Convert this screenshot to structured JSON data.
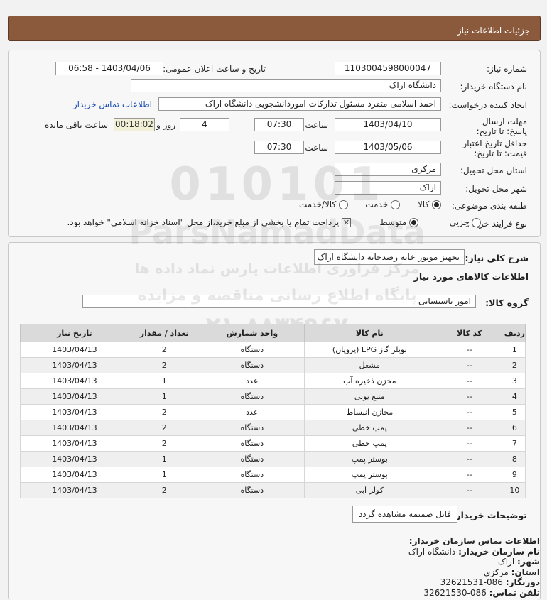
{
  "page_title": "جزئیات اطلاعات نیاز",
  "form": {
    "need_number_label": "شماره نیاز:",
    "need_number": "1103004598000047",
    "announce_label": "تاریخ و ساعت اعلان عمومی:",
    "announce_value": "1403/04/06 - 06:58",
    "buyer_org_label": "نام دستگاه خریدار:",
    "buyer_org": "دانشگاه اراک",
    "creator_label": "ایجاد کننده درخواست:",
    "creator": "احمد  اسلامی متفرد مسئول تدارکات اموردانشجویی دانشگاه اراک",
    "contact_link": "اطلاعات تماس خریدار",
    "deadline_label": "مهلت ارسال پاسخ: تا تاریخ:",
    "deadline_date": "1403/04/10",
    "time_label": "ساعت",
    "deadline_time": "07:30",
    "days_value": "4",
    "days_label": "روز و",
    "remaining_time": "00:18:02",
    "remaining_label": "ساعت باقی مانده",
    "validity_label": "حداقل تاریخ اعتبار قیمت: تا تاریخ:",
    "validity_date": "1403/05/06",
    "validity_time": "07:30",
    "province_label": "استان محل تحویل:",
    "province": "مرکزی",
    "city_label": "شهر محل تحویل:",
    "city": "اراک",
    "category_label": "طبقه بندی موضوعی:",
    "category_options": [
      "کالا",
      "خدمت",
      "کالا/خدمت"
    ],
    "category_selected": "کالا",
    "process_label": "نوع فرآیند خرید :",
    "process_options": [
      "جزیی",
      "متوسط"
    ],
    "process_selected": "متوسط",
    "payment_note": "پرداخت تمام یا بخشی از مبلغ خرید،از محل \"اسناد خزانه اسلامی\" خواهد بود."
  },
  "summary": {
    "label": "شرح کلی نیاز:",
    "value": "تجهیز موتور خانه رصدخانه دانشگاه اراک"
  },
  "goods": {
    "section_title": "اطلاعات کالاهای مورد نیاز",
    "group_label": "گروه کالا:",
    "group_value": "امور تاسیساتی",
    "columns": [
      "ردیف",
      "کد کالا",
      "نام کالا",
      "واحد شمارش",
      "تعداد / مقدار",
      "تاریخ نیاز"
    ],
    "rows": [
      [
        "1",
        "--",
        "بویلر گاز LPG (پروپان)",
        "دستگاه",
        "2",
        "1403/04/13"
      ],
      [
        "2",
        "--",
        "مشعل",
        "دستگاه",
        "2",
        "1403/04/13"
      ],
      [
        "3",
        "--",
        "مخزن ذخیره آب",
        "عدد",
        "1",
        "1403/04/13"
      ],
      [
        "4",
        "--",
        "منبع یونی",
        "دستگاه",
        "1",
        "1403/04/13"
      ],
      [
        "5",
        "--",
        "مخازن انبساط",
        "عدد",
        "2",
        "1403/04/13"
      ],
      [
        "6",
        "--",
        "پمپ خطی",
        "دستگاه",
        "2",
        "1403/04/13"
      ],
      [
        "7",
        "--",
        "پمپ خطی",
        "دستگاه",
        "2",
        "1403/04/13"
      ],
      [
        "8",
        "--",
        "بوستر پمپ",
        "دستگاه",
        "1",
        "1403/04/13"
      ],
      [
        "9",
        "--",
        "بوستر پمپ",
        "دستگاه",
        "1",
        "1403/04/13"
      ],
      [
        "10",
        "--",
        "کولر آبی",
        "دستگاه",
        "2",
        "1403/04/13"
      ]
    ]
  },
  "buyer_notes": {
    "label": "توضیحات خریدار:",
    "value": "فایل ضمیمه مشاهده گردد"
  },
  "contact": {
    "title": "اطلاعات تماس سازمان خریدار:",
    "org_label": "نام سازمان خریدار:",
    "org_value": "دانشگاه اراک",
    "city_label": "شهر:",
    "city_value": "اراک",
    "province_label": "استان:",
    "province_value": "مرکزی",
    "fax_label": "دورنگار:",
    "fax_value": "086-32621531",
    "phone_label": "تلفن تماس:",
    "phone_value": "086-32621530"
  },
  "watermark": {
    "site": "ParsNamadData",
    "line1": "مرکز فرآوری اطلاعات پارس نماد داده ها",
    "line2": "پایگاه اطلاع رسانی مناقصه و مزایده",
    "phone": "۰۲۱-۸۸۳۴۹۶۷۰",
    "digits": "010101"
  }
}
